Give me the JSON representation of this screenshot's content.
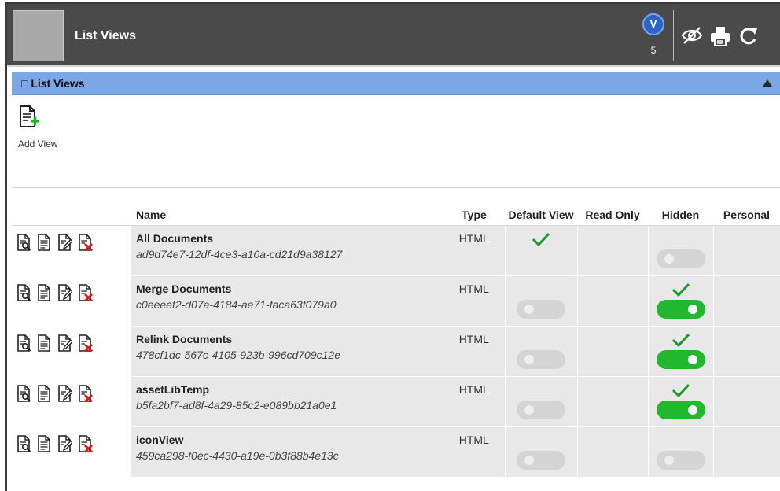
{
  "window": {
    "title": "List Views",
    "notifications": {
      "letter": "V",
      "count": "5"
    },
    "tools": [
      "hide-icon",
      "print-icon",
      "refresh-icon"
    ]
  },
  "section": {
    "title": "□ List Views"
  },
  "toolbar": {
    "add_view_label": "Add View"
  },
  "table": {
    "headers": {
      "name": "Name",
      "type": "Type",
      "default_view": "Default View",
      "read_only": "Read Only",
      "hidden": "Hidden",
      "personal": "Personal"
    },
    "rows": [
      {
        "name": "All Documents",
        "id": "ad9d74e7-12df-4ce3-a10a-cd21d9a38127",
        "type": "HTML",
        "default_view": true,
        "read_only": false,
        "hidden": false,
        "personal": false
      },
      {
        "name": "Merge Documents",
        "id": "c0eeeef2-d07a-4184-ae71-faca63f079a0",
        "type": "HTML",
        "default_view": false,
        "read_only": false,
        "hidden": true,
        "personal": false
      },
      {
        "name": "Relink Documents",
        "id": "478cf1dc-567c-4105-923b-996cd709c12e",
        "type": "HTML",
        "default_view": false,
        "read_only": false,
        "hidden": true,
        "personal": false
      },
      {
        "name": "assetLibTemp",
        "id": "b5fa2bf7-ad8f-4a29-85c2-e089bb21a0e1",
        "type": "HTML",
        "default_view": false,
        "read_only": false,
        "hidden": true,
        "personal": false
      },
      {
        "name": "iconView",
        "id": "459ca298-f0ec-4430-a19e-0b3f88b4e13c",
        "type": "HTML",
        "default_view": false,
        "read_only": false,
        "hidden": false,
        "personal": false
      }
    ]
  },
  "colors": {
    "titlebar": "#4a4a4a",
    "section_header": "#7ba7e6",
    "toggle_on": "#21b830",
    "toggle_off": "#d4d4d4",
    "check": "#1f9a2a",
    "badge": "#2c63c7",
    "delete_x": "#d11a1a"
  }
}
